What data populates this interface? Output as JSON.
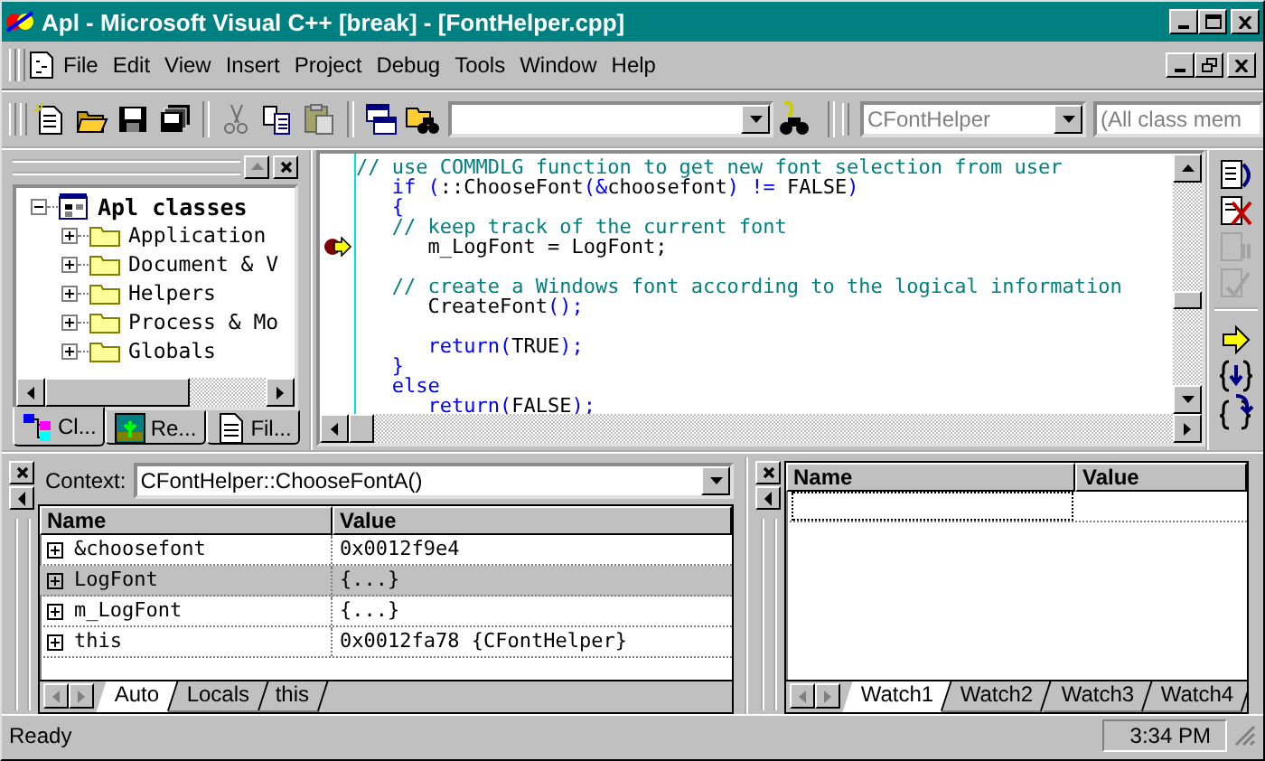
{
  "window": {
    "title": "Apl - Microsoft Visual C++ [break] - [FontHelper.cpp]"
  },
  "menu": [
    "File",
    "Edit",
    "View",
    "Insert",
    "Project",
    "Debug",
    "Tools",
    "Window",
    "Help"
  ],
  "toolbar": {
    "buttons": [
      {
        "kind": "new",
        "disabled": false
      },
      {
        "kind": "open",
        "disabled": false
      },
      {
        "kind": "save",
        "disabled": false
      },
      {
        "kind": "save_all",
        "disabled": false
      },
      {
        "kind": "cut",
        "disabled": true
      },
      {
        "kind": "copy",
        "disabled": false
      },
      {
        "kind": "paste",
        "disabled": true
      },
      {
        "kind": "workspace",
        "disabled": false
      },
      {
        "kind": "find_in_files",
        "disabled": false
      }
    ],
    "class_combo": {
      "value": "CFontHelper",
      "disabled": true
    },
    "member_combo": {
      "value": "(All class mem",
      "disabled": true
    }
  },
  "class_view": {
    "tree": {
      "label": "Apl classes",
      "expanded": true,
      "children": [
        {
          "label": "Application",
          "expanded": false
        },
        {
          "label": "Document & V",
          "expanded": false
        },
        {
          "label": "Helpers",
          "expanded": false
        },
        {
          "label": "Process & Mo",
          "expanded": false
        },
        {
          "label": "Globals",
          "expanded": false
        }
      ]
    },
    "tabs": [
      {
        "kind": "classes",
        "label": "Cl...",
        "selected": true
      },
      {
        "kind": "resources",
        "label": "Re...",
        "selected": false
      },
      {
        "kind": "files",
        "label": "Fil...",
        "selected": false
      }
    ]
  },
  "editor": {
    "lines": [
      {
        "kind": "code",
        "current": false,
        "tokens": [
          {
            "kind": "comment",
            "text": "// use COMMDLG function to get new font selection from user"
          }
        ]
      },
      {
        "kind": "code",
        "current": false,
        "tokens": [
          {
            "kind": "keyword",
            "text": "   if ("
          },
          {
            "kind": "plain",
            "text": "::ChooseFont"
          },
          {
            "kind": "keyword",
            "text": "(&"
          },
          {
            "kind": "plain",
            "text": "choosefont"
          },
          {
            "kind": "keyword",
            "text": ") != "
          },
          {
            "kind": "plain",
            "text": "FALSE"
          },
          {
            "kind": "keyword",
            "text": ")"
          }
        ]
      },
      {
        "kind": "code",
        "current": false,
        "tokens": [
          {
            "kind": "keyword",
            "text": "   {"
          }
        ]
      },
      {
        "kind": "code",
        "current": false,
        "tokens": [
          {
            "kind": "comment",
            "text": "   // keep track of the current font"
          }
        ]
      },
      {
        "kind": "code",
        "current": true,
        "tokens": [
          {
            "kind": "plain",
            "text": "      m_LogFont = LogFont;"
          }
        ]
      },
      {
        "kind": "blank"
      },
      {
        "kind": "code",
        "current": false,
        "tokens": [
          {
            "kind": "comment",
            "text": "   // create a Windows font according to the logical information"
          }
        ]
      },
      {
        "kind": "code",
        "current": false,
        "tokens": [
          {
            "kind": "plain",
            "text": "      CreateFont"
          },
          {
            "kind": "keyword",
            "text": "();"
          }
        ]
      },
      {
        "kind": "blank"
      },
      {
        "kind": "code",
        "current": false,
        "tokens": [
          {
            "kind": "keyword",
            "text": "      return("
          },
          {
            "kind": "plain",
            "text": "TRUE"
          },
          {
            "kind": "keyword",
            "text": ");"
          }
        ]
      },
      {
        "kind": "code",
        "current": false,
        "tokens": [
          {
            "kind": "keyword",
            "text": "   }"
          }
        ]
      },
      {
        "kind": "code",
        "current": false,
        "tokens": [
          {
            "kind": "keyword",
            "text": "   else"
          }
        ]
      },
      {
        "kind": "code",
        "current": false,
        "tokens": [
          {
            "kind": "keyword",
            "text": "      return("
          },
          {
            "kind": "plain",
            "text": "FALSE"
          },
          {
            "kind": "keyword",
            "text": ");"
          }
        ]
      }
    ]
  },
  "debug_toolbar": {
    "buttons": [
      {
        "kind": "restart",
        "disabled": false
      },
      {
        "kind": "stop",
        "disabled": false
      },
      {
        "kind": "break",
        "disabled": true
      },
      {
        "kind": "apply_code",
        "disabled": true
      },
      {
        "kind": "show_next",
        "disabled": false
      },
      {
        "kind": "step_into",
        "disabled": false
      },
      {
        "kind": "step_over",
        "disabled": false
      }
    ]
  },
  "variables": {
    "context_label": "Context:",
    "context": "CFontHelper::ChooseFontA()",
    "columns": [
      "Name",
      "Value"
    ],
    "rows": [
      {
        "name": "&choosefont",
        "value": "0x0012f9e4",
        "selected": false
      },
      {
        "name": "LogFont",
        "value": "{...}",
        "selected": true
      },
      {
        "name": "m_LogFont",
        "value": "{...}",
        "selected": false
      },
      {
        "name": "this",
        "value": "0x0012fa78 {CFontHelper}",
        "selected": false
      }
    ],
    "tabs": [
      {
        "label": "Auto",
        "selected": true
      },
      {
        "label": "Locals",
        "selected": false
      },
      {
        "label": "this",
        "selected": false
      }
    ]
  },
  "watch": {
    "columns": [
      "Name",
      "Value"
    ],
    "tabs": [
      {
        "label": "Watch1",
        "selected": true
      },
      {
        "label": "Watch2",
        "selected": false
      },
      {
        "label": "Watch3",
        "selected": false
      },
      {
        "label": "Watch4",
        "selected": false
      }
    ]
  },
  "status_bar": {
    "message": "Ready",
    "time": "3:34 PM"
  }
}
